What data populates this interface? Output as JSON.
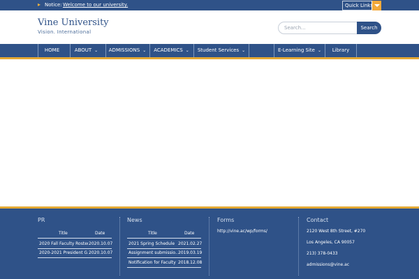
{
  "topbar": {
    "notice_icon": "megaphone-icon",
    "notice_label": "Notice:",
    "notice_text": "Welcome to our university.",
    "quick_links_label": "Quick Links"
  },
  "header": {
    "title": "Vine University",
    "tagline": "Vision. International",
    "search_placeholder": "Search...",
    "search_button": "Search"
  },
  "nav": {
    "items": [
      {
        "label": "HOME"
      },
      {
        "label": "ABOUT"
      },
      {
        "label": "ADMISSIONS"
      },
      {
        "label": "ACADEMICS"
      },
      {
        "label": "Student Services"
      },
      {
        "label": ""
      },
      {
        "label": "E-Learning Site"
      },
      {
        "label": "Library"
      }
    ]
  },
  "footer": {
    "pr": {
      "heading": "PR",
      "col_title": "Title",
      "col_date": "Date",
      "rows": [
        {
          "title": "2020 Fall Faculty Roster",
          "date": "2020.10.07"
        },
        {
          "title": "2020-2021 President G..",
          "date": "2020.10.07"
        }
      ]
    },
    "news": {
      "heading": "News",
      "col_title": "Title",
      "col_date": "Date",
      "rows": [
        {
          "title": "2021 Spring Schedule",
          "date": "2021.02.27"
        },
        {
          "title": "Assignment submissio..",
          "date": "2019.03.19"
        },
        {
          "title": "Notification for Faculty",
          "date": "2018.12.08"
        }
      ]
    },
    "forms": {
      "heading": "Forms",
      "link": "http://vine.ac/wp/forms/"
    },
    "contact": {
      "heading": "Contact",
      "address1": "2120 West 8th Street, #270",
      "address2": "Los Angeles, CA 90057",
      "phone": "213) 378-0433",
      "email": "admissions@vine.ac"
    }
  },
  "colors": {
    "primary": "#2f5288",
    "accent": "#e3a834"
  }
}
